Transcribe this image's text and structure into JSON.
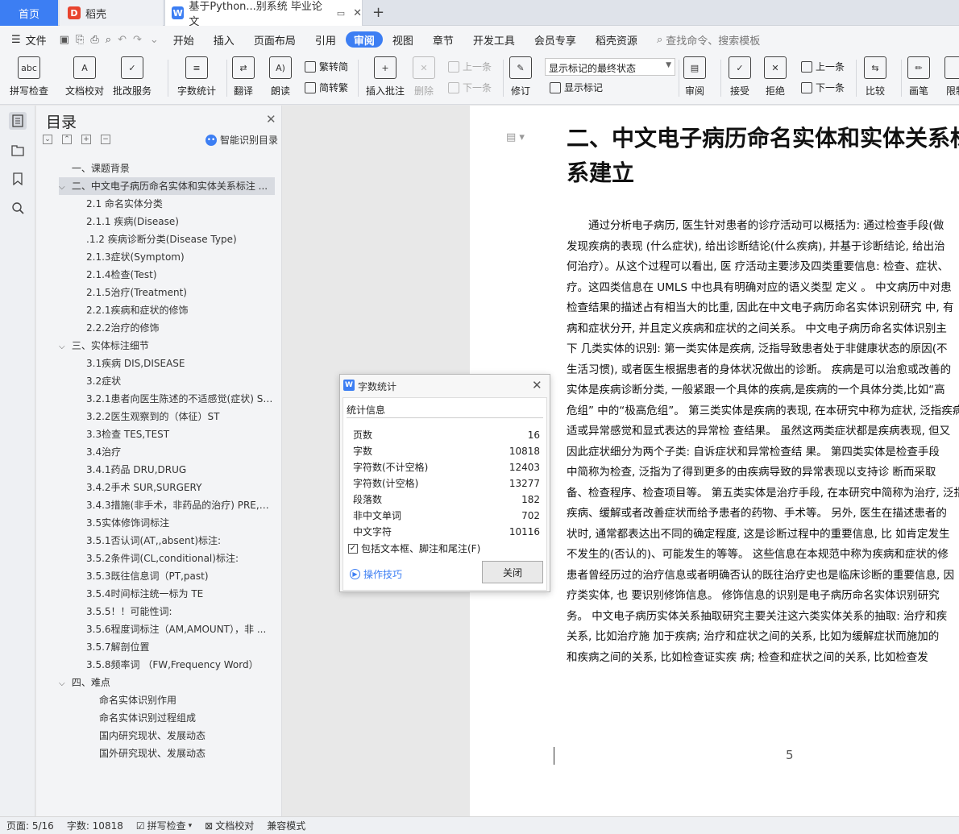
{
  "tabs": {
    "home": "首页",
    "daoke": "稻壳",
    "doc": "基于Python...别系统 毕业论文"
  },
  "menu": {
    "file": "文件",
    "items": [
      "开始",
      "插入",
      "页面布局",
      "引用",
      "审阅",
      "视图",
      "章节",
      "开发工具",
      "会员专享",
      "稻壳资源"
    ],
    "search": "查找命令、搜索模板"
  },
  "ribbon": {
    "spell": "拼写检查",
    "doccheck": "文档校对",
    "batch": "批改服务",
    "wordcount": "字数统计",
    "translate": "翻译",
    "read": "朗读",
    "t2s": "繁转简",
    "s2t": "简转繁",
    "insertcomment": "插入批注",
    "delete": "删除",
    "prev1": "上一条",
    "next1": "下一条",
    "revise": "修订",
    "markmode": "显示标记的最终状态",
    "showmark": "显示标记",
    "review": "审阅",
    "accept": "接受",
    "reject": "拒绝",
    "prev2": "上一条",
    "next2": "下一条",
    "compare": "比较",
    "pen": "画笔",
    "limit": "限制"
  },
  "toc": {
    "title": "目录",
    "smart": "智能识别目录",
    "items": [
      {
        "text": "一、课题背景",
        "level": 1
      },
      {
        "text": "二、中文电子病历命名实体和实体关系标注 ...",
        "level": 1,
        "expanded": true,
        "selected": true
      },
      {
        "text": "2.1 命名实体分类",
        "level": 2
      },
      {
        "text": "2.1.1 疾病(Disease)",
        "level": 2
      },
      {
        "text": ".1.2 疾病诊断分类(Disease Type)",
        "level": 2
      },
      {
        "text": "2.1.3症状(Symptom)",
        "level": 2
      },
      {
        "text": "2.1.4检查(Test)",
        "level": 2
      },
      {
        "text": "2.1.5治疗(Treatment)",
        "level": 2
      },
      {
        "text": "2.2.1疾病和症状的修饰",
        "level": 2
      },
      {
        "text": "2.2.2治疗的修饰",
        "level": 2
      },
      {
        "text": "三、实体标注细节",
        "level": 1,
        "expanded": true
      },
      {
        "text": "3.1疾病 DIS,DISEASE",
        "level": 2
      },
      {
        "text": "3.2症状",
        "level": 2
      },
      {
        "text": "3.2.1患者向医生陈述的不适感觉(症状) S ...",
        "level": 2
      },
      {
        "text": "3.2.2医生观察到的（体征）ST",
        "level": 2
      },
      {
        "text": "3.3检查 TES,TEST",
        "level": 2
      },
      {
        "text": "3.4治疗",
        "level": 2
      },
      {
        "text": "3.4.1药品 DRU,DRUG",
        "level": 2
      },
      {
        "text": "3.4.2手术 SUR,SURGERY",
        "level": 2
      },
      {
        "text": "3.4.3措施(非手术，非药品的治疗) PRE,p ...",
        "level": 2
      },
      {
        "text": "3.5实体修饰词标注",
        "level": 2
      },
      {
        "text": "3.5.1否认词(AT,,absent)标注:",
        "level": 2
      },
      {
        "text": "3.5.2条件词(CL,conditional)标注:",
        "level": 2
      },
      {
        "text": "3.5.3既往信息词（PT,past)",
        "level": 2
      },
      {
        "text": "3.5.4时间标注统一标为 TE",
        "level": 2
      },
      {
        "text": "3.5.5！！可能性词:",
        "level": 2
      },
      {
        "text": "3.5.6程度词标注（AM,AMOUNT），非 ...",
        "level": 2
      },
      {
        "text": "3.5.7解剖位置",
        "level": 2
      },
      {
        "text": "3.5.8频率词 （FW,Frequency Word）",
        "level": 2
      },
      {
        "text": "四、难点",
        "level": 1,
        "expanded": true
      },
      {
        "text": "命名实体识别作用",
        "level": 3
      },
      {
        "text": "命名实体识别过程组成",
        "level": 3
      },
      {
        "text": "国内研究现状、发展动态",
        "level": 3
      },
      {
        "text": "国外研究现状、发展动态",
        "level": 3
      }
    ]
  },
  "doc": {
    "h1a": "二、中文电子病历命名实体和实体关系标",
    "h1b": "系建立",
    "lines": [
      "　　通过分析电子病历, 医生针对患者的诊疗活动可以概括为: 通过检查手段(做",
      "发现疾病的表现 (什么症状), 给出诊断结论(什么疾病), 并基于诊断结论, 给出治",
      "何治疗）。从这个过程可以看出, 医 疗活动主要涉及四类重要信息: 检查、症状、",
      "疗。这四类信息在 UMLS 中也具有明确对应的语义类型 定义 。 中文病历中对患",
      "检查结果的描述占有相当大的比重, 因此在中文电子病历命名实体识别研究 中, 有",
      "病和症状分开, 并且定义疾病和症状的之间关系。 中文电子病历命名实体识别主",
      "下 几类实体的识别: 第一类实体是疾病, 泛指导致患者处于非健康状态的原因(不",
      "生活习惯), 或者医生根据患者的身体状况做出的诊断。 疾病是可以治愈或改善的",
      "实体是疾病诊断分类, 一般紧跟一个具体的疾病,是疾病的一个具体分类,比如“高",
      "危组” 中的“极高危组”。 第三类实体是疾病的表现, 在本研究中称为症状, 泛指疾病",
      "适或异常感觉和显式表达的异常检 查结果。 虽然这两类症状都是疾病表现, 但又",
      "因此症状细分为两个子类: 自诉症状和异常检查结 果。 第四类实体是检查手段",
      "中简称为检查, 泛指为了得到更多的由疾病导致的异常表现以支持诊 断而采取",
      "备、检查程序、检查项目等。 第五类实体是治疗手段, 在本研究中简称为治疗, 泛指",
      "疾病、缓解或者改善症状而给予患者的药物、手术等。 另外, 医生在描述患者的",
      "状时, 通常都表达出不同的确定程度, 这是诊断过程中的重要信息, 比 如肯定发生",
      "不发生的(否认的)、可能发生的等等。 这些信息在本规范中称为疾病和症状的修",
      "患者曾经历过的治疗信息或者明确否认的既往治疗史也是临床诊断的重要信息, 因",
      "疗类实体, 也 要识别修饰信息。 修饰信息的识别是电子病历命名实体识别研究",
      "务。 中文电子病历实体关系抽取研究主要关注这六类实体关系的抽取: 治疗和疾",
      "关系, 比如治疗施 加于疾病; 治疗和症状之间的关系, 比如为缓解症状而施加的",
      "和疾病之间的关系, 比如检查证实疾 病; 检查和症状之间的关系, 比如检查发"
    ],
    "page_number": "5"
  },
  "dialog": {
    "title": "字数统计",
    "section": "统计信息",
    "rows": [
      {
        "label": "页数",
        "value": "16"
      },
      {
        "label": "字数",
        "value": "10818"
      },
      {
        "label": "字符数(不计空格)",
        "value": "12403"
      },
      {
        "label": "字符数(计空格)",
        "value": "13277"
      },
      {
        "label": "段落数",
        "value": "182"
      },
      {
        "label": "非中文单词",
        "value": "702"
      },
      {
        "label": "中文字符",
        "value": "10116"
      }
    ],
    "checkbox": "包括文本框、脚注和尾注(F)",
    "tips": "操作技巧",
    "close": "关闭"
  },
  "status": {
    "page": "页面: 5/16",
    "words": "字数: 10818",
    "spell": "拼写检查",
    "doccheck": "文档校对",
    "compat": "兼容模式"
  },
  "colors": {
    "accent": "#3c7ef3"
  }
}
